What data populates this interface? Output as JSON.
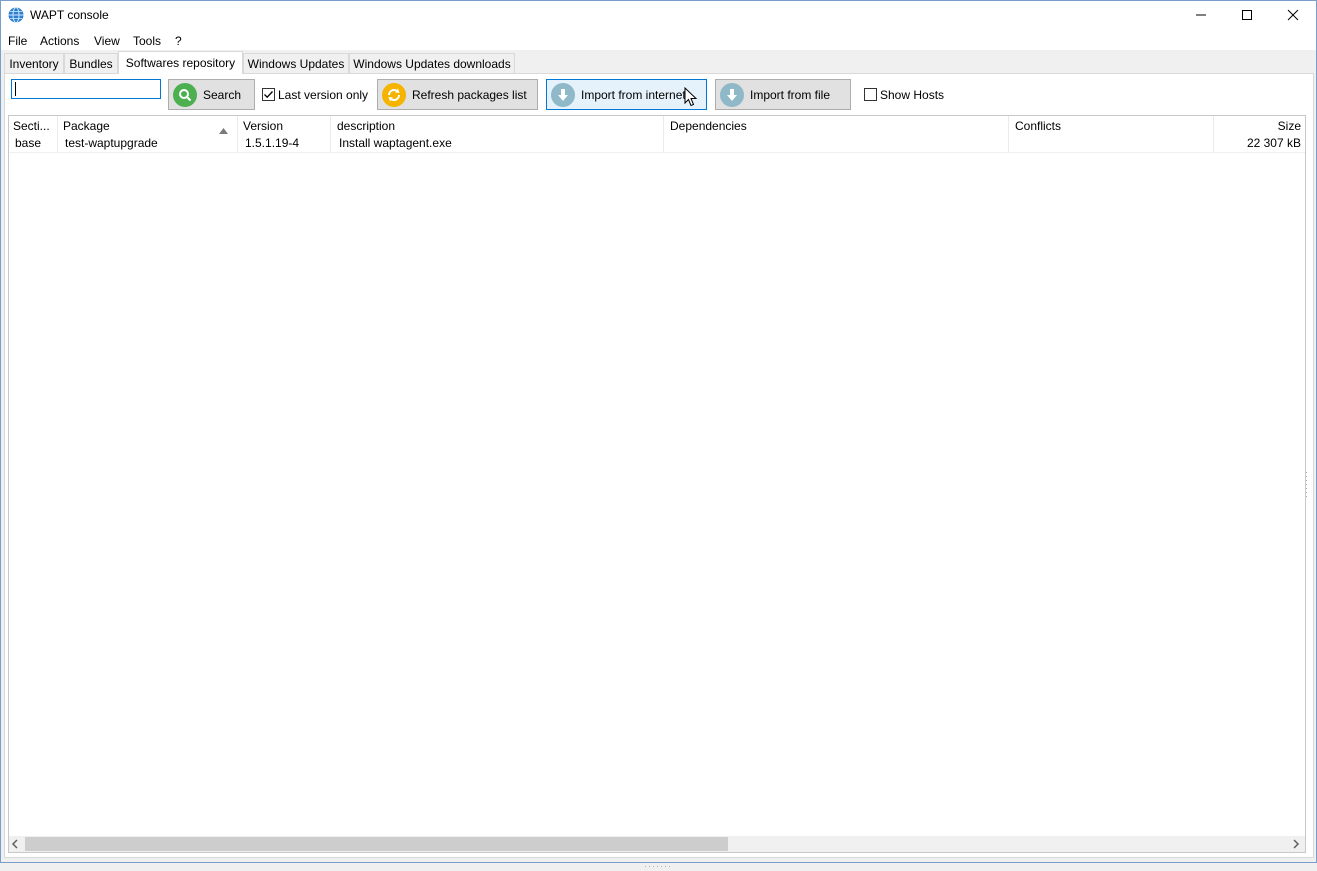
{
  "window": {
    "title": "WAPT console"
  },
  "menu": [
    "File",
    "Actions",
    "View",
    "Tools",
    "?"
  ],
  "tabs": [
    {
      "label": "Inventory",
      "active": false
    },
    {
      "label": "Bundles",
      "active": false
    },
    {
      "label": "Softwares repository",
      "active": true
    },
    {
      "label": "Windows Updates",
      "active": false
    },
    {
      "label": "Windows Updates downloads",
      "active": false
    }
  ],
  "toolbar": {
    "search_value": "",
    "search_label": "Search",
    "last_version_label": "Last version only",
    "last_version_checked": true,
    "refresh_label": "Refresh packages list",
    "import_internet_label": "Import from internet",
    "import_file_label": "Import from file",
    "show_hosts_label": "Show Hosts",
    "show_hosts_checked": false
  },
  "grid": {
    "columns": [
      "Secti...",
      "Package",
      "Version",
      "description",
      "Dependencies",
      "Conflicts",
      "Size"
    ],
    "sort_column": "Package",
    "rows": [
      {
        "section": "base",
        "package": "test-waptupgrade",
        "version": "1.5.1.19-4",
        "description": "Install waptagent.exe",
        "dependencies": "",
        "conflicts": "",
        "size": "22 307 kB"
      }
    ]
  },
  "colors": {
    "accent": "#0078d7",
    "search_icon": "#4caf50",
    "refresh_icon": "#f5b400",
    "import_icon": "#8fb8c8"
  }
}
